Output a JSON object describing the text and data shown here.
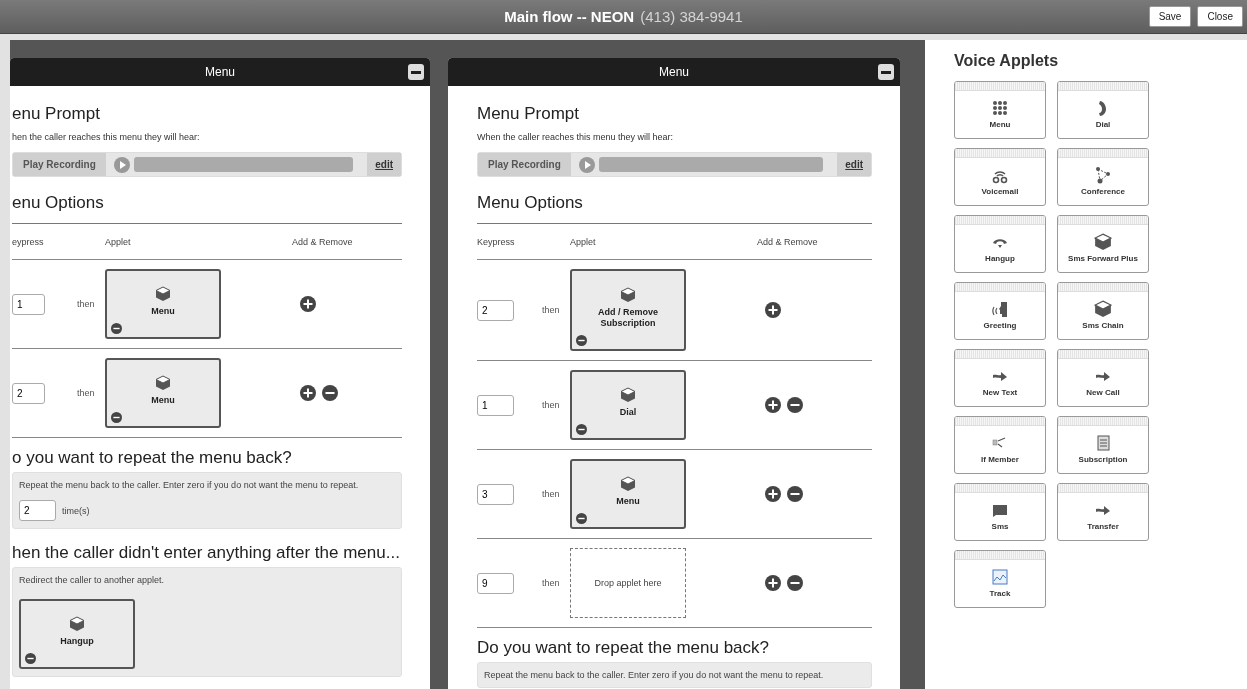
{
  "title": {
    "flow": "Main flow -- NEON",
    "phone": "(413) 384-9941"
  },
  "buttons": [
    "Save",
    "Close"
  ],
  "panels": [
    {
      "header": "Menu",
      "prompt_heading": "enu Prompt",
      "prompt_text": "hen the caller reaches this menu they will hear:",
      "play_label": "Play Recording",
      "edit_link": "edit",
      "options_heading": "enu Options",
      "columns": [
        "eypress",
        "Applet",
        "Add & Remove"
      ],
      "options": [
        {
          "key": "1",
          "then": "then",
          "kind": "applet",
          "label": "Menu",
          "removable": false
        },
        {
          "key": "2",
          "then": "then",
          "kind": "applet",
          "label": "Menu",
          "removable": true
        }
      ],
      "repeat": {
        "heading": "o you want to repeat the menu back?",
        "text": "Repeat the menu back to the caller. Enter zero if you do not want the menu to repeat.",
        "times": "2",
        "unit": "time(s)"
      },
      "fallback": {
        "heading": "hen the caller didn't enter anything after the menu...",
        "text": "Redirect the caller to another applet.",
        "label": "Hangup"
      }
    },
    {
      "header": "Menu",
      "prompt_heading": "Menu Prompt",
      "prompt_text": "When the caller reaches this menu they will hear:",
      "play_label": "Play Recording",
      "edit_link": "edit",
      "options_heading": "Menu Options",
      "columns": [
        "Keypress",
        "Applet",
        "Add & Remove"
      ],
      "options": [
        {
          "key": "2",
          "then": "then",
          "kind": "applet",
          "label": "Add / Remove Subscription",
          "removable": false
        },
        {
          "key": "1",
          "then": "then",
          "kind": "applet",
          "label": "Dial",
          "removable": true
        },
        {
          "key": "3",
          "then": "then",
          "kind": "applet",
          "label": "Menu",
          "removable": true
        },
        {
          "key": "9",
          "then": "then",
          "kind": "drop",
          "label": "Drop applet here",
          "removable": true
        }
      ],
      "repeat": {
        "heading": "Do you want to repeat the menu back?",
        "text": "Repeat the menu back to the caller. Enter zero if you do not want the menu to repeat."
      }
    }
  ],
  "sidebar": {
    "heading": "Voice Applets",
    "applets": [
      {
        "label": "Menu",
        "kind": "keypad"
      },
      {
        "label": "Dial",
        "kind": "phone"
      },
      {
        "label": "Voicemail",
        "kind": "voicemail"
      },
      {
        "label": "Conference",
        "kind": "conference"
      },
      {
        "label": "Hangup",
        "kind": "hangup"
      },
      {
        "label": "Sms Forward Plus",
        "kind": "cube"
      },
      {
        "label": "Greeting",
        "kind": "greeting"
      },
      {
        "label": "Sms Chain",
        "kind": "cube"
      },
      {
        "label": "New Text",
        "kind": "arrow"
      },
      {
        "label": "New Call",
        "kind": "arrow"
      },
      {
        "label": "If Member",
        "kind": "branch"
      },
      {
        "label": "Subscription",
        "kind": "document"
      },
      {
        "label": "Sms",
        "kind": "sms"
      },
      {
        "label": "Transfer",
        "kind": "arrow"
      },
      {
        "label": "Track",
        "kind": "chart"
      }
    ]
  }
}
